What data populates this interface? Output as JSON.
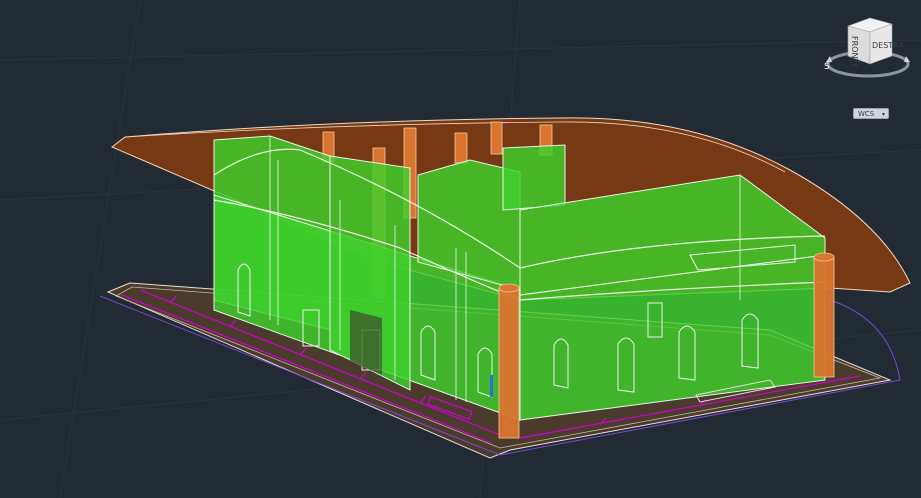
{
  "viewcube": {
    "face_front_label": "FRONTE",
    "face_right_label": "DESTRA"
  },
  "ucs_menu": {
    "label": "WCS",
    "arrow_icon": "chevron-down-icon"
  },
  "colors": {
    "background": "#222a33",
    "walls": "#3ed12c",
    "roof": "#8a3f13",
    "columns": "#d9752e",
    "base_slab": "#4a3a2c",
    "dimension_lines": "#d000d0",
    "outline": "#e8f2e8"
  }
}
